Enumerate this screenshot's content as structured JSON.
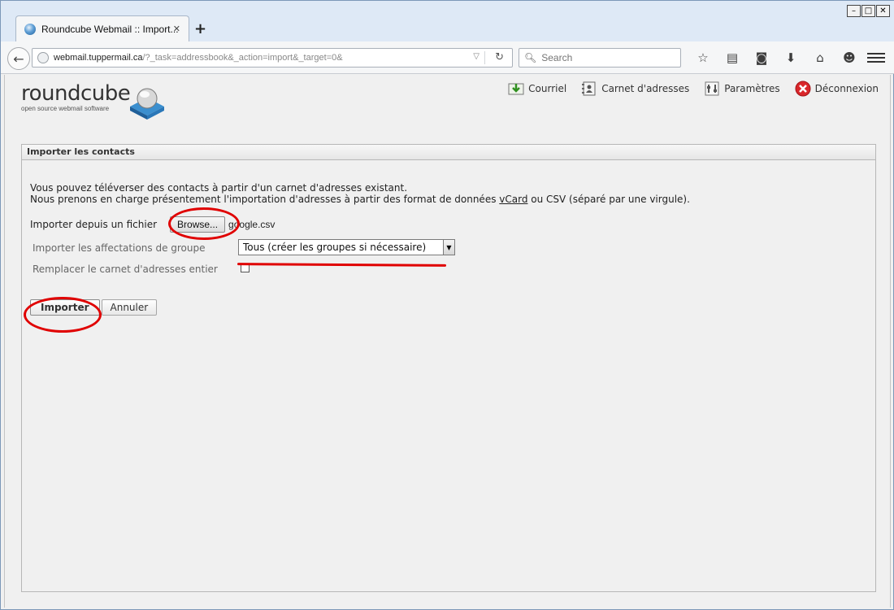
{
  "browser": {
    "tab_title": "Roundcube Webmail :: Import...",
    "new_tab": "+",
    "url_domain": "webmail.tuppermail.ca",
    "url_rest": "/?_task=addressbook&_action=import&_target=0&",
    "search_placeholder": "Search",
    "window_controls": [
      "minimize",
      "maximize",
      "close"
    ]
  },
  "logo": {
    "wordmark": "roundcube",
    "tagline": "open source webmail software"
  },
  "topnav": {
    "mail": "Courriel",
    "addressbook": "Carnet d'adresses",
    "settings": "Paramètres",
    "logout": "Déconnexion"
  },
  "panel": {
    "title": "Importer les contacts",
    "intro_line1": "Vous pouvez téléverser des contacts à partir d'un carnet d'adresses existant.",
    "intro_line2_a": "Nous prenons en charge présentement l'importation d'adresses à partir des format de données ",
    "intro_link": "vCard",
    "intro_line2_b": " ou CSV (séparé par une virgule).",
    "file_label": "Importer depuis un fichier",
    "browse_label": "Browse...",
    "file_name": "google.csv",
    "groups_label": "Importer les affectations de groupe",
    "groups_value": "Tous (créer les groupes si nécessaire)",
    "replace_label": "Remplacer le carnet d'adresses entier",
    "replace_checked": false,
    "import_button": "Importer",
    "cancel_button": "Annuler"
  },
  "colors": {
    "annotation": "#e00000",
    "logout_icon": "#d9262a"
  }
}
